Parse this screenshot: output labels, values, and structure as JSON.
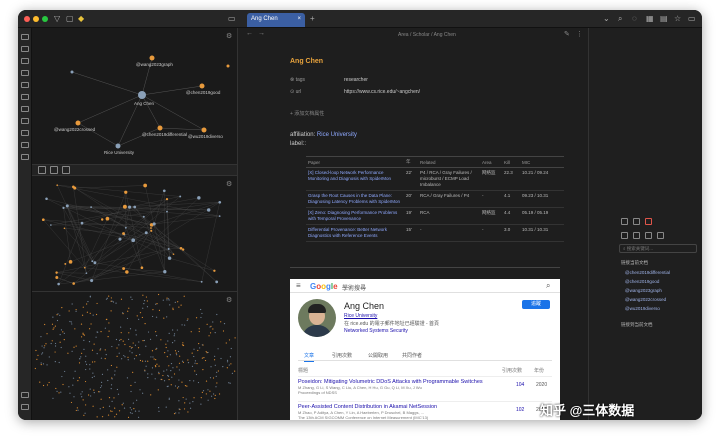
{
  "tab": {
    "title": "Ang Chen"
  },
  "breadcrumb": {
    "text": "Area / Scholar / Ang Chen"
  },
  "page": {
    "title": "Ang Chen"
  },
  "properties": [
    {
      "key": "tags",
      "value": "researcher"
    },
    {
      "key": "url",
      "value": "https://www.cs.rice.edu/~angchen/"
    }
  ],
  "add_property": "+ 添加文档属性",
  "affiliation": {
    "label": "affiliation:",
    "value": "Rice University"
  },
  "label_line": "label::",
  "graph": {
    "nodes": [
      {
        "label": "@wang2023graph"
      },
      {
        "label": "Ang Chen"
      },
      {
        "label": "@chen2019good"
      },
      {
        "label": "@wang2022crossed"
      },
      {
        "label": "@chen2019differential"
      },
      {
        "label": "@wu2019diverso"
      },
      {
        "label": "Rice University"
      }
    ]
  },
  "table": {
    "headers": [
      "Paper",
      "年",
      "Related",
      "Area",
      "Kill",
      "MIC"
    ],
    "rows": [
      {
        "paper": "[X] Closed-loop Network Performance Monitoring and Diagnosis with SpiderMon",
        "year": "22'",
        "related": "P4 / RCA / Gray Failures / microburst / ECMP Load Imbalance",
        "area": "网络监",
        "kill": "22.3",
        "mic": "10.21 / 09.24"
      },
      {
        "paper": "Grasp the Root Causes in the Data Plane: Diagnosing Latency Problems with SpiderMon",
        "year": "20'",
        "related": "RCA / Gray Failures / P4",
        "area": "-",
        "kill": "4.1",
        "mic": "09.23 / 10.31"
      },
      {
        "paper": "[X] Zeno: Diagnosing Performance Problems with Temporal Provenance",
        "year": "19'",
        "related": "RCA",
        "area": "网络监",
        "kill": "4.4",
        "mic": "05.19 / 05.19"
      },
      {
        "paper": "Differential Provenance: Better Network Diagnostics with Reference Events",
        "year": "15'",
        "related": "-",
        "area": "-",
        "kill": "3.0",
        "mic": "10.31 / 10.31"
      }
    ]
  },
  "scholar": {
    "brand": "Google",
    "heading": "學術搜尋",
    "name": "Ang Chen",
    "affiliation": "Rice University",
    "email": "在 rice.edu 的電子郵件地址已經驗證 - 首頁",
    "interests": "Networked Systems   Security",
    "follow": "追蹤",
    "tabs": [
      "文章",
      "引用次數",
      "公開取用",
      "共同作者"
    ],
    "col_title": "標題",
    "col_cited": "引用次數",
    "col_year": "年份",
    "articles": [
      {
        "title": "Poseidon: Mitigating Volumetric DDoS Attacks with Programmable Switches",
        "authors": "M Zhang, G Li, S Wang, C Liu, A Chen, H Hu, G Gu, Q Li, M Xu, J Wu",
        "venue": "Proceedings of NDSS",
        "cited": "104",
        "year": "2020"
      },
      {
        "title": "Peer-Assisted Content Distribution in Akamai NetSession",
        "authors": "M Zhao, P Aditya, A Chen, Y Lin, A Haeberlen, P Druschel, B Maggs, ...",
        "venue": "The 13th ACM SIGCOMM Conference on Internet Measurement (IMC'13)",
        "cited": "102",
        "year": "2013"
      }
    ]
  },
  "right_pane": {
    "search_placeholder": "搜索关键词...",
    "links_heading": "链接当前文档",
    "links": [
      "@chen2019differential",
      "@chen2019good",
      "@wang2023graph",
      "@wang2022crossed",
      "@wu2019diverso"
    ],
    "outgoing_heading": "链接到当前文档"
  },
  "watermark": "知乎 @三体数据"
}
